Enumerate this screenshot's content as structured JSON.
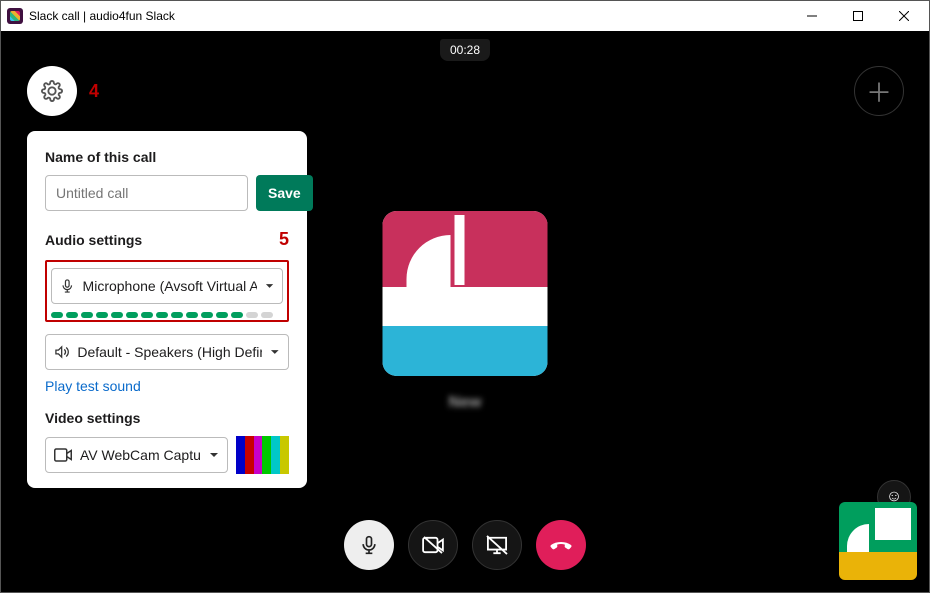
{
  "window": {
    "title": "Slack call | audio4fun Slack"
  },
  "call": {
    "timer": "00:28"
  },
  "callouts": {
    "gear": "4",
    "audio": "5"
  },
  "panel": {
    "name_label": "Name of this call",
    "name_placeholder": "Untitled call",
    "save_label": "Save",
    "audio_label": "Audio settings",
    "mic_value": "Microphone (Avsoft Virtual Aud",
    "mic_level_active": 13,
    "mic_level_total": 15,
    "speaker_value": "Default - Speakers (High Defini",
    "test_link": "Play test sound",
    "video_label": "Video settings",
    "camera_value": "AV WebCam Captu",
    "color_bars": [
      "#0000c8",
      "#c80000",
      "#c800c8",
      "#00c800",
      "#00c8c8",
      "#c8c800"
    ]
  },
  "participant": {
    "name": "New"
  },
  "controls": {
    "mic": "mic",
    "camera": "camera-off",
    "share": "share-off",
    "end": "hangup"
  }
}
